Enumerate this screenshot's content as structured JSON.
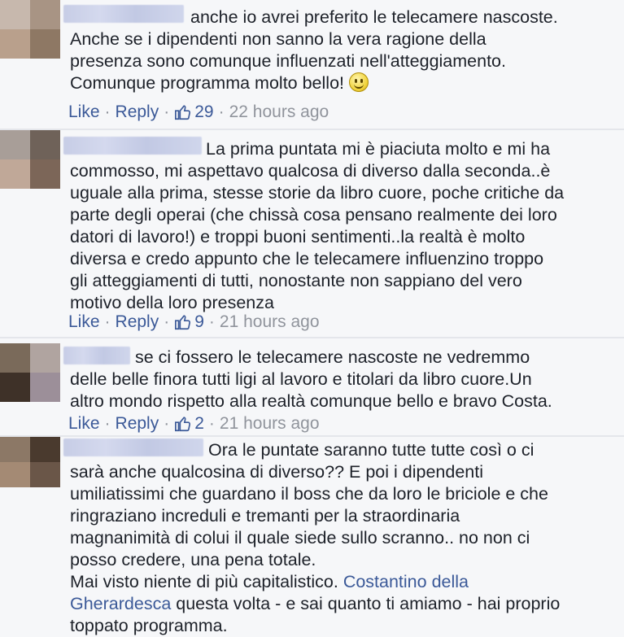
{
  "comments": [
    {
      "text": "anche io avrei preferito le telecamere nascoste.\nAnche se i dipendenti non sanno la vera ragione della\npresenza sono comunque influenzati nell'atteggiamento.\nComunque programma molto bello!",
      "like_label": "Like",
      "reply_label": "Reply",
      "like_count": "29",
      "time": "22 hours ago",
      "emoji": "smile-emoji"
    },
    {
      "text": "La prima puntata mi è piaciuta molto e mi ha\ncommosso, mi aspettavo qualcosa di diverso dalla seconda..è\nuguale alla prima, stesse storie da libro cuore, poche critiche da\nparte degli operai (che chissà cosa pensano realmente dei loro\ndatori di lavoro!) e troppi buoni sentimenti..la realtà è molto\ndiversa e credo appunto che le telecamere influenzino troppo\ngli atteggiamenti di tutti, nonostante non sappiano del vero\nmotivo della loro presenza",
      "like_label": "Like",
      "reply_label": "Reply",
      "like_count": "9",
      "time": "21 hours ago"
    },
    {
      "text": "se ci fossero le telecamere nascoste ne vedremmo\ndelle belle finora tutti ligi al lavoro e titolari da libro cuore.Un\naltro mondo rispetto alla realtà comunque bello e bravo Costa.",
      "like_label": "Like",
      "reply_label": "Reply",
      "like_count": "2",
      "time": "21 hours ago"
    },
    {
      "text_before_link": "Ora le puntate saranno tutte tutte così o ci\nsarà anche qualcosina di diverso?? E poi i dipendenti\numiliatissimi che guardano il boss che da loro le briciole e che\nringraziano increduli e tremanti per la straordinaria\nmagnanimità di colui il quale siede sullo scranno.. no non ci\nposso credere, una pena totale.\nMai visto niente di più capitalistico. ",
      "link": "Costantino della\nGherardesca",
      "text_after_link": " questa volta - e sai quanto ti amiamo - hai proprio\ntoppato programma."
    }
  ],
  "colors": {
    "link": "#3b5998",
    "meta": "#90949c",
    "background": "#f6f7f9"
  },
  "icons": {
    "like_count_icon": "thumbs-up-icon"
  }
}
